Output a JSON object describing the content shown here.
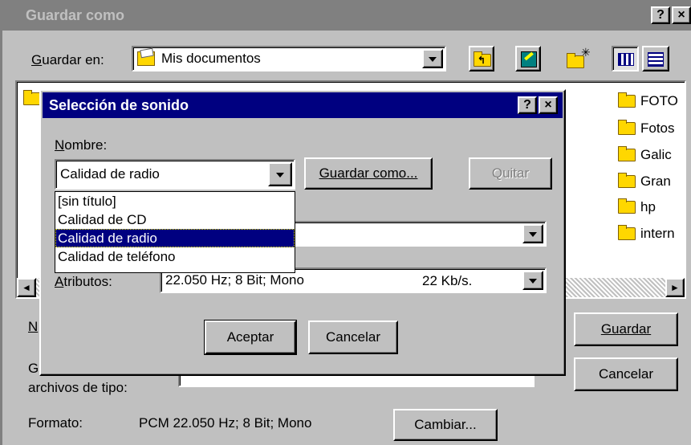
{
  "outer": {
    "title": "Guardar como",
    "help_btn": "?",
    "close_btn": "×",
    "save_in_label": "Guardar en:",
    "save_in_value": "Mis documentos",
    "files": [
      "FOTO",
      "Fotos",
      "Galic",
      "Gran",
      "hp",
      "intern"
    ],
    "name_label": "N",
    "type_label_line1": "G",
    "type_label_line2": "archivos de tipo:",
    "format_label": "Formato:",
    "format_value": "PCM 22.050 Hz; 8 Bit; Mono",
    "change_btn": "Cambiar...",
    "save_btn": "Guardar",
    "cancel_btn": "Cancelar",
    "toolbar_icons": [
      "up-folder-icon",
      "desktop-icon",
      "new-folder-icon",
      "list-view-icon",
      "details-view-icon"
    ]
  },
  "dialog": {
    "title": "Selección de sonido",
    "help_btn": "?",
    "close_btn": "×",
    "name_label": "Nombre:",
    "name_value": "Calidad de radio",
    "save_as_btn": "Guardar como...",
    "remove_btn": "Quitar",
    "dropdown_options": [
      "[sin título]",
      "Calidad de CD",
      "Calidad de radio",
      "Calidad de teléfono"
    ],
    "selected_option": "Calidad de radio",
    "attributes_label": "Atributos:",
    "attributes_value": "22.050 Hz; 8 Bit; Mono",
    "attributes_rate": "22 Kb/s.",
    "accept_btn": "Aceptar",
    "cancel_btn": "Cancelar"
  },
  "colors": {
    "face": "#c0c0c0",
    "active_title": "#000080",
    "inactive_title": "#808080",
    "selection": "#000080"
  }
}
